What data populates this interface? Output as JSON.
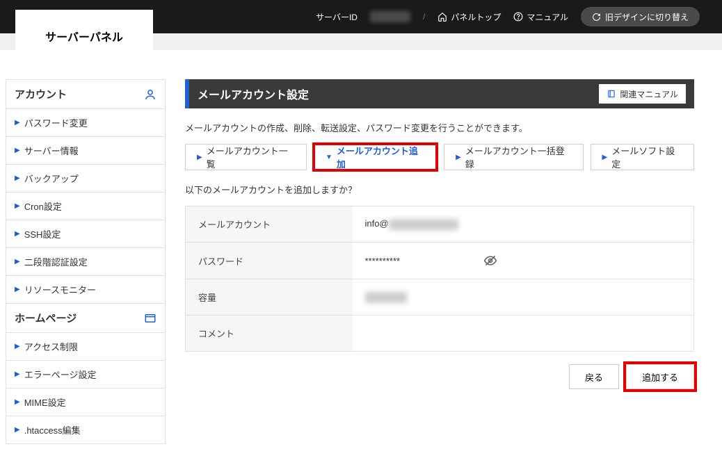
{
  "top": {
    "brand": "サーバーパネル",
    "server_id_label": "サーバーID",
    "slash": "/",
    "panel_top": "パネルトップ",
    "manual": "マニュアル",
    "switch_old": "旧デザインに切り替え"
  },
  "sidebar": {
    "groups": [
      {
        "title": "アカウント",
        "icon": "user",
        "items": [
          {
            "label": "パスワード変更"
          },
          {
            "label": "サーバー情報"
          },
          {
            "label": "バックアップ"
          },
          {
            "label": "Cron設定"
          },
          {
            "label": "SSH設定"
          },
          {
            "label": "二段階認証設定"
          },
          {
            "label": "リソースモニター"
          }
        ]
      },
      {
        "title": "ホームページ",
        "icon": "window",
        "items": [
          {
            "label": "アクセス制限"
          },
          {
            "label": "エラーページ設定"
          },
          {
            "label": "MIME設定"
          },
          {
            "label": ".htaccess編集"
          }
        ]
      }
    ]
  },
  "header": {
    "title": "メールアカウント設定",
    "related_manual": "関連マニュアル"
  },
  "description": "メールアカウントの作成、削除、転送設定、パスワード変更を行うことができます。",
  "tabs": [
    {
      "label": "メールアカウント一覧",
      "active": false
    },
    {
      "label": "メールアカウント追加",
      "active": true
    },
    {
      "label": "メールアカウント一括登録",
      "active": false
    },
    {
      "label": "メールソフト設定",
      "active": false
    }
  ],
  "confirm_text": "以下のメールアカウントを追加しますか？",
  "form": {
    "rows": [
      {
        "label": "メールアカウント",
        "value": "info@",
        "masked_suffix": true
      },
      {
        "label": "パスワード",
        "value": "**********",
        "eye": true
      },
      {
        "label": "容量",
        "value": "",
        "masked_full": true
      },
      {
        "label": "コメント",
        "value": ""
      }
    ]
  },
  "actions": {
    "back": "戻る",
    "submit": "追加する"
  }
}
